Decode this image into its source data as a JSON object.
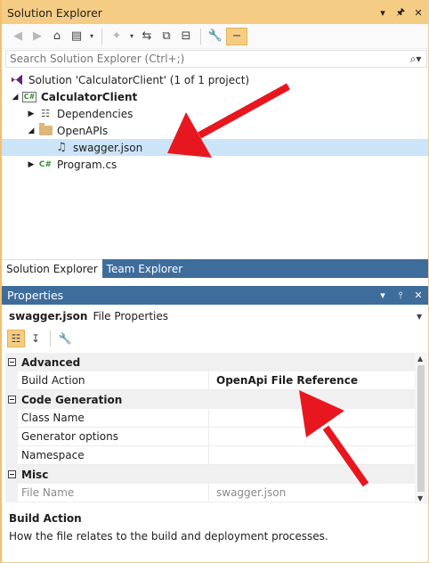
{
  "solution_explorer": {
    "title": "Solution Explorer",
    "window_buttons": [
      "▾",
      "ᚚ",
      "✕"
    ],
    "search_placeholder": "Search Solution Explorer (Ctrl+;)",
    "tree": [
      {
        "label": "Solution 'CalculatorClient' (1 of 1 project)",
        "icon": "solution-icon"
      },
      {
        "label": "CalculatorClient",
        "icon": "csharp-project-icon"
      },
      {
        "label": "Dependencies",
        "icon": "dependencies-icon"
      },
      {
        "label": "OpenAPIs",
        "icon": "folder-icon"
      },
      {
        "label": "swagger.json",
        "icon": "json-file-icon"
      },
      {
        "label": "Program.cs",
        "icon": "csharp-file-icon"
      }
    ],
    "tabs": [
      "Solution Explorer",
      "Team Explorer"
    ]
  },
  "properties": {
    "title": "Properties",
    "object_name": "swagger.json",
    "object_kind": "File Properties",
    "categories": [
      {
        "name": "Advanced",
        "rows": [
          {
            "name": "Build Action",
            "value": "OpenApi File Reference"
          }
        ]
      },
      {
        "name": "Code Generation",
        "rows": [
          {
            "name": "Class Name",
            "value": ""
          },
          {
            "name": "Generator options",
            "value": ""
          },
          {
            "name": "Namespace",
            "value": ""
          }
        ]
      },
      {
        "name": "Misc",
        "rows": [
          {
            "name": "File Name",
            "value": "swagger.json"
          }
        ]
      }
    ],
    "description_title": "Build Action",
    "description_text": "How the file relates to the build and deployment processes."
  },
  "colors": {
    "accent": "#f5cc84",
    "tab_blue": "#3e6d9c",
    "selection": "#cce4f7",
    "arrow": "#e8161e"
  }
}
